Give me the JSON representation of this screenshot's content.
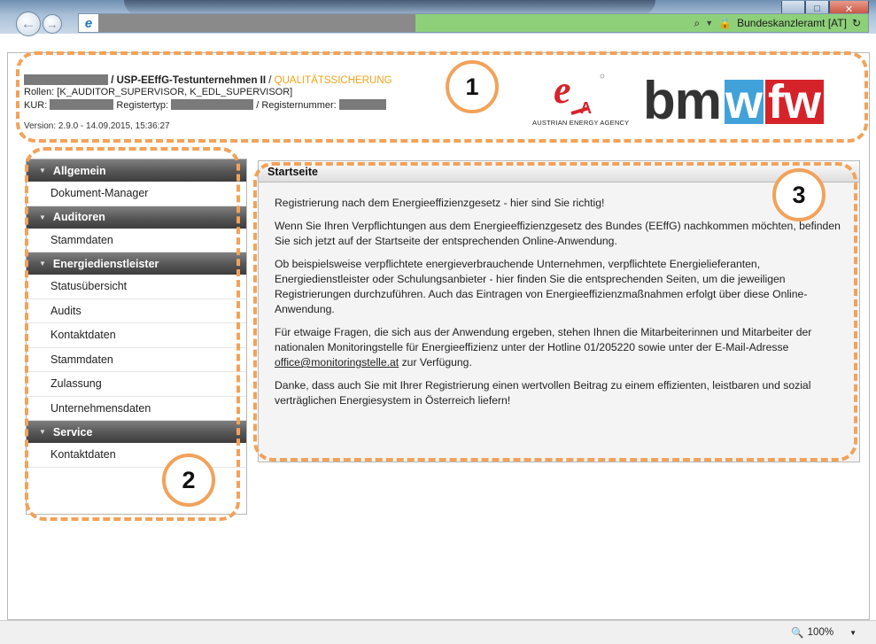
{
  "browser": {
    "address_right": "Bundeskanzleramt [AT]",
    "window_controls": [
      "minimize",
      "maximize",
      "close"
    ]
  },
  "header": {
    "org_name": "USP-EEffG-Testunternehmen II",
    "separator": " / ",
    "qs_label": "QUALITÄTSSICHERUNG",
    "roles": "Rollen: [K_AUDITOR_SUPERVISOR, K_EDL_SUPERVISOR]",
    "kur_label": "KUR:",
    "registertyp_label": "Registertyp:",
    "registernummer_label": "/ Registernummer:",
    "version": "Version: 2.9.0 - 14.09.2015, 15:36:27",
    "ea_caption": "AUSTRIAN ENERGY AGENCY",
    "bmwfw_bm": "bm",
    "bmwfw_w": "w",
    "bmwfw_fw": "fw"
  },
  "sidebar": {
    "groups": [
      {
        "title": "Allgemein",
        "items": [
          "Dokument-Manager"
        ]
      },
      {
        "title": "Auditoren",
        "items": [
          "Stammdaten"
        ]
      },
      {
        "title": "Energiedienstleister",
        "items": [
          "Statusübersicht",
          "Audits",
          "Kontaktdaten",
          "Stammdaten",
          "Zulassung",
          "Unternehmensdaten"
        ]
      },
      {
        "title": "Service",
        "items": [
          "Kontaktdaten"
        ]
      }
    ]
  },
  "content": {
    "title": "Startseite",
    "p1": "Registrierung nach dem Energieeffizienzgesetz - hier sind Sie richtig!",
    "p2": "Wenn Sie Ihren Verpflichtungen aus dem Energieeffizienzgesetz des Bundes (EEffG) nachkommen möchten, befinden Sie sich jetzt auf der Startseite der entsprechenden Online-Anwendung.",
    "p3": "Ob beispielsweise verpflichtete energieverbrauchende Unternehmen, verpflichtete Energielieferanten, Energiedienstleister oder Schulungsanbieter - hier finden Sie die entsprechenden Seiten, um die jeweiligen Registrierungen durchzuführen. Auch das Eintragen von Energieeffizienzmaßnahmen erfolgt über diese Online-Anwendung.",
    "p4_before": "Für etwaige Fragen, die sich aus der Anwendung ergeben, stehen Ihnen die Mitarbeiterinnen und Mitarbeiter der nationalen Monitoringstelle für Energieeffizienz unter der Hotline 01/205220 sowie unter der E-Mail-Adresse ",
    "p4_link": "office@monitoringstelle.at",
    "p4_after": " zur Verfügung.",
    "p5": "Danke, dass auch Sie mit Ihrer Registrierung einen wertvollen Beitrag zu einem effizienten, leistbaren und sozial verträglichen Energiesystem in Österreich liefern!"
  },
  "annotations": {
    "badge1": "1",
    "badge2": "2",
    "badge3": "3",
    "color": "#f2a25a"
  },
  "statusbar": {
    "zoom": "100%"
  }
}
